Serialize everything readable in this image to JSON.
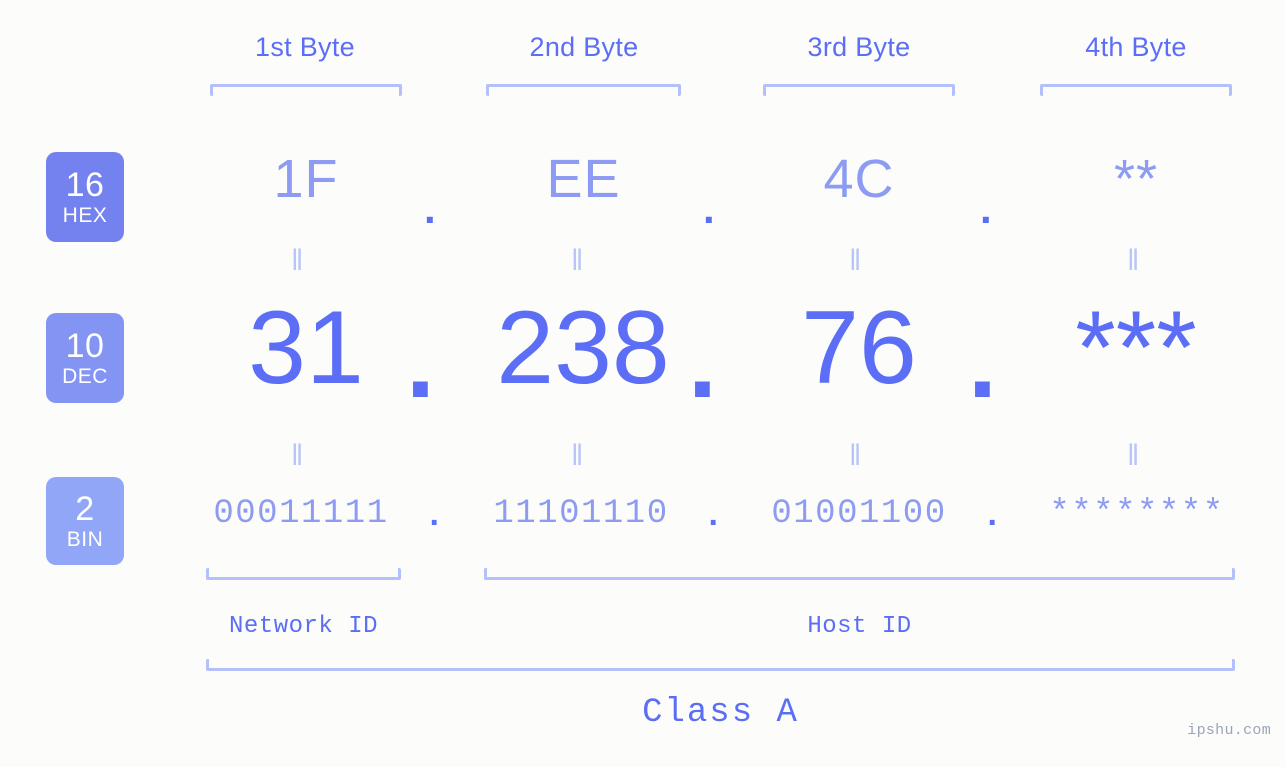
{
  "background_color": "#fcfdfa",
  "accent_color": "#5b6ef5",
  "muted_accent_color": "#8d9cf2",
  "bracket_color": "#b4c0fb",
  "byte_headers": [
    {
      "label": "1st Byte"
    },
    {
      "label": "2nd Byte"
    },
    {
      "label": "3rd Byte"
    },
    {
      "label": "4th Byte"
    }
  ],
  "bases": [
    {
      "number": "16",
      "name": "HEX",
      "color": "#7382ee"
    },
    {
      "number": "10",
      "name": "DEC",
      "color": "#8494f2"
    },
    {
      "number": "2",
      "name": "BIN",
      "color": "#92a6f7"
    }
  ],
  "rows": {
    "hex": {
      "values": [
        "1F",
        "EE",
        "4C",
        "**"
      ],
      "separator": "."
    },
    "dec": {
      "values": [
        "31",
        "238",
        "76",
        "***"
      ],
      "separator": "."
    },
    "bin": {
      "values": [
        "00011111",
        "11101110",
        "01001100",
        "********"
      ],
      "separator": "."
    }
  },
  "equals_marks": {
    "glyph": "‖",
    "count_per_gap": 4
  },
  "segments": {
    "network_id": {
      "label": "Network ID"
    },
    "host_id": {
      "label": "Host ID"
    },
    "class": {
      "label": "Class A"
    }
  },
  "watermark": {
    "text": "ipshu.com"
  },
  "ip_address": {
    "dotted_decimal": "31.238.76.***",
    "hex": "1F.EE.4C.**",
    "binary": "00011111.11101110.01001100.********",
    "class": "Class A"
  }
}
